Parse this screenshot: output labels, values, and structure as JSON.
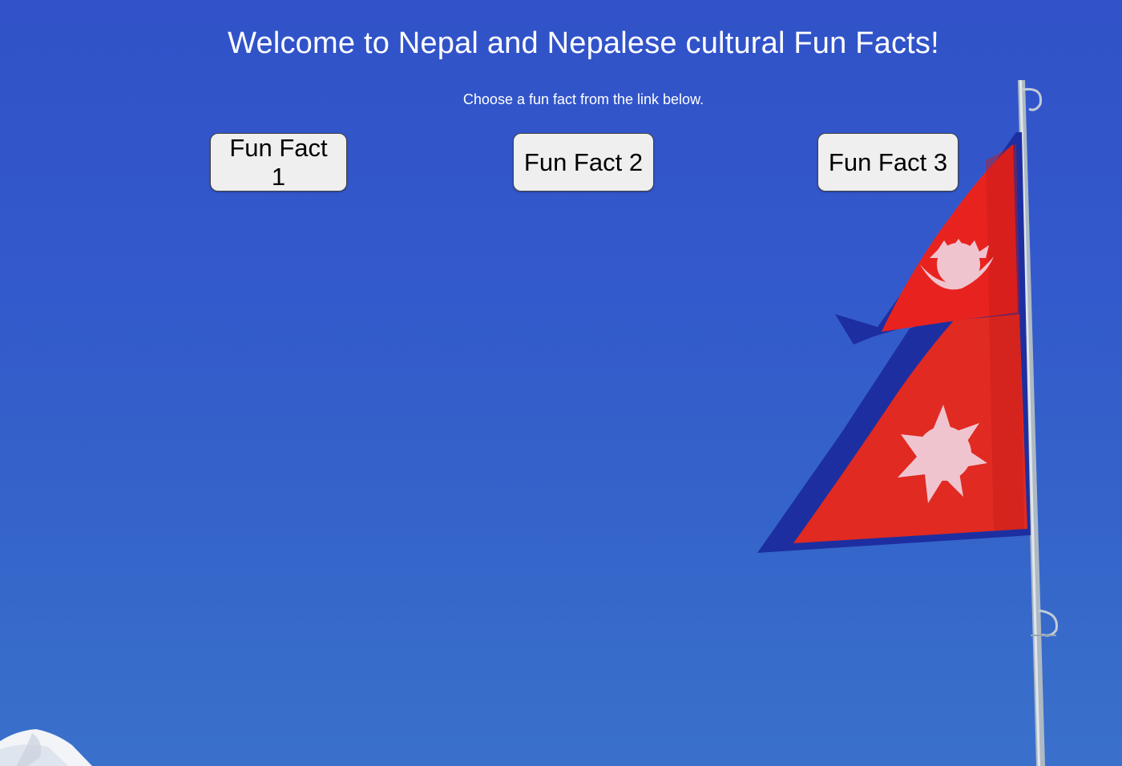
{
  "header": {
    "title": "Welcome to Nepal and Nepalese cultural Fun Facts!",
    "subtitle": "Choose a fun fact from the link below."
  },
  "buttons": [
    {
      "label": "Fun Fact 1"
    },
    {
      "label": "Fun Fact 2"
    },
    {
      "label": "Fun Fact 3"
    }
  ],
  "background": {
    "sky_color": "#3359cc",
    "flag_red": "#e8231f",
    "flag_border": "#1d2fa0",
    "emblem_color": "#f0c4cf",
    "pole_color": "#b8c4cf"
  }
}
